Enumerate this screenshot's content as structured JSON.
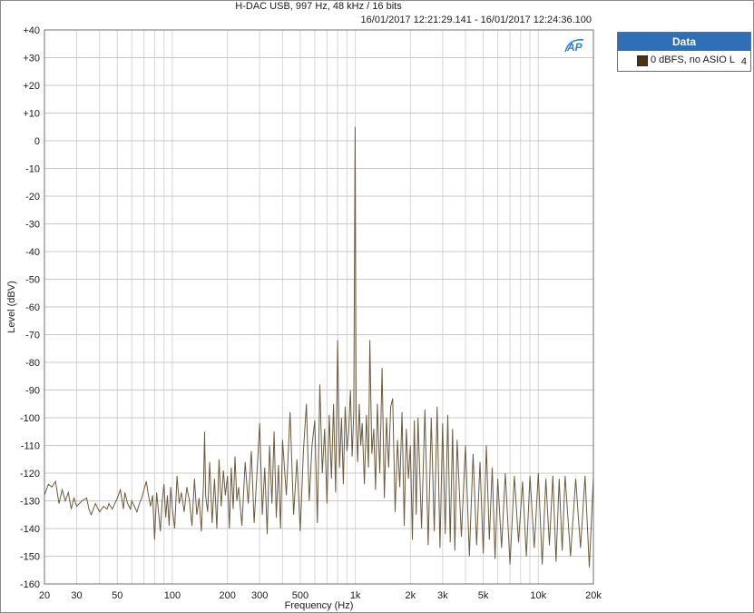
{
  "title": "H-DAC USB, 997 Hz, 48 kHz / 16 bits",
  "subtitle": "16/01/2017 12:21:29.141 - 16/01/2017 12:24:36.100",
  "legend": {
    "header": "Data",
    "entries": [
      {
        "label": "0 dBFS, no ASIO L",
        "channel": "4",
        "color": "#4a3410"
      }
    ]
  },
  "logo_text": "AP",
  "colors": {
    "trace": "#6b5a3e",
    "legend_header": "#2f6fb5",
    "grid": "#d6d6d6"
  },
  "chart_data": {
    "type": "line",
    "title": "H-DAC USB, 997 Hz, 48 kHz / 16 bits",
    "subtitle": "16/01/2017 12:21:29.141 - 16/01/2017 12:24:36.100",
    "xlabel": "Frequency (Hz)",
    "ylabel": "Level (dBV)",
    "xscale": "log",
    "xlim": [
      20,
      20000
    ],
    "ylim": [
      -160,
      40
    ],
    "x_ticks": [
      {
        "value": 20,
        "label": "20"
      },
      {
        "value": 30,
        "label": "30"
      },
      {
        "value": 50,
        "label": "50"
      },
      {
        "value": 100,
        "label": "100"
      },
      {
        "value": 200,
        "label": "200"
      },
      {
        "value": 300,
        "label": "300"
      },
      {
        "value": 500,
        "label": "500"
      },
      {
        "value": 1000,
        "label": "1k"
      },
      {
        "value": 2000,
        "label": "2k"
      },
      {
        "value": 3000,
        "label": "3k"
      },
      {
        "value": 5000,
        "label": "5k"
      },
      {
        "value": 10000,
        "label": "10k"
      },
      {
        "value": 20000,
        "label": "20k"
      }
    ],
    "y_ticks": [
      {
        "value": 40,
        "label": "+40"
      },
      {
        "value": 30,
        "label": "+30"
      },
      {
        "value": 20,
        "label": "+20"
      },
      {
        "value": 10,
        "label": "+10"
      },
      {
        "value": 0,
        "label": "0"
      },
      {
        "value": -10,
        "label": "-10"
      },
      {
        "value": -20,
        "label": "-20"
      },
      {
        "value": -30,
        "label": "-30"
      },
      {
        "value": -40,
        "label": "-40"
      },
      {
        "value": -50,
        "label": "-50"
      },
      {
        "value": -60,
        "label": "-60"
      },
      {
        "value": -70,
        "label": "-70"
      },
      {
        "value": -80,
        "label": "-80"
      },
      {
        "value": -90,
        "label": "-90"
      },
      {
        "value": -100,
        "label": "-100"
      },
      {
        "value": -110,
        "label": "-110"
      },
      {
        "value": -120,
        "label": "-120"
      },
      {
        "value": -130,
        "label": "-130"
      },
      {
        "value": -140,
        "label": "-140"
      },
      {
        "value": -150,
        "label": "-150"
      },
      {
        "value": -160,
        "label": "-160"
      }
    ],
    "grid": true,
    "legend_position": "outside-right",
    "series": [
      {
        "name": "0 dBFS, no ASIO L",
        "color": "#6b5a3e",
        "points": [
          [
            20,
            -128
          ],
          [
            21,
            -124
          ],
          [
            22,
            -125
          ],
          [
            23,
            -123
          ],
          [
            24,
            -131
          ],
          [
            25,
            -126
          ],
          [
            26,
            -130
          ],
          [
            27,
            -127
          ],
          [
            28,
            -133
          ],
          [
            29,
            -129
          ],
          [
            30,
            -132
          ],
          [
            32,
            -130
          ],
          [
            34,
            -129
          ],
          [
            35,
            -133
          ],
          [
            36,
            -135
          ],
          [
            38,
            -131
          ],
          [
            40,
            -134
          ],
          [
            42,
            -132
          ],
          [
            44,
            -133
          ],
          [
            45,
            -131
          ],
          [
            47,
            -133
          ],
          [
            50,
            -129
          ],
          [
            52,
            -126
          ],
          [
            54,
            -133
          ],
          [
            55,
            -127
          ],
          [
            57,
            -131
          ],
          [
            59,
            -133
          ],
          [
            60,
            -130
          ],
          [
            62,
            -132
          ],
          [
            64,
            -134
          ],
          [
            66,
            -131
          ],
          [
            68,
            -129
          ],
          [
            70,
            -126
          ],
          [
            72,
            -123
          ],
          [
            74,
            -128
          ],
          [
            76,
            -132
          ],
          [
            78,
            -128
          ],
          [
            80,
            -144
          ],
          [
            82,
            -127
          ],
          [
            84,
            -134
          ],
          [
            86,
            -141
          ],
          [
            88,
            -130
          ],
          [
            90,
            -124
          ],
          [
            92,
            -136
          ],
          [
            94,
            -128
          ],
          [
            96,
            -139
          ],
          [
            98,
            -125
          ],
          [
            100,
            -133
          ],
          [
            103,
            -140
          ],
          [
            106,
            -121
          ],
          [
            109,
            -131
          ],
          [
            112,
            -127
          ],
          [
            116,
            -134
          ],
          [
            120,
            -125
          ],
          [
            124,
            -130
          ],
          [
            128,
            -139
          ],
          [
            132,
            -122
          ],
          [
            136,
            -135
          ],
          [
            140,
            -129
          ],
          [
            144,
            -141
          ],
          [
            148,
            -124
          ],
          [
            150,
            -105
          ],
          [
            152,
            -128
          ],
          [
            156,
            -134
          ],
          [
            160,
            -116
          ],
          [
            165,
            -138
          ],
          [
            170,
            -122
          ],
          [
            175,
            -140
          ],
          [
            180,
            -115
          ],
          [
            185,
            -132
          ],
          [
            190,
            -119
          ],
          [
            195,
            -128
          ],
          [
            200,
            -121
          ],
          [
            205,
            -140
          ],
          [
            210,
            -118
          ],
          [
            215,
            -133
          ],
          [
            220,
            -114
          ],
          [
            225,
            -130
          ],
          [
            230,
            -125
          ],
          [
            240,
            -139
          ],
          [
            250,
            -116
          ],
          [
            260,
            -131
          ],
          [
            270,
            -112
          ],
          [
            280,
            -138
          ],
          [
            290,
            -120
          ],
          [
            300,
            -102
          ],
          [
            310,
            -135
          ],
          [
            320,
            -118
          ],
          [
            330,
            -142
          ],
          [
            340,
            -110
          ],
          [
            350,
            -131
          ],
          [
            360,
            -105
          ],
          [
            370,
            -136
          ],
          [
            380,
            -117
          ],
          [
            390,
            -140
          ],
          [
            400,
            -108
          ],
          [
            420,
            -128
          ],
          [
            440,
            -98
          ],
          [
            460,
            -135
          ],
          [
            480,
            -115
          ],
          [
            500,
            -141
          ],
          [
            520,
            -112
          ],
          [
            540,
            -95
          ],
          [
            560,
            -130
          ],
          [
            580,
            -110
          ],
          [
            600,
            -101
          ],
          [
            620,
            -138
          ],
          [
            640,
            -88
          ],
          [
            660,
            -120
          ],
          [
            680,
            -104
          ],
          [
            700,
            -131
          ],
          [
            720,
            -99
          ],
          [
            740,
            -122
          ],
          [
            760,
            -95
          ],
          [
            780,
            -127
          ],
          [
            800,
            -72
          ],
          [
            820,
            -118
          ],
          [
            840,
            -100
          ],
          [
            860,
            -124
          ],
          [
            880,
            -96
          ],
          [
            900,
            -112
          ],
          [
            920,
            -105
          ],
          [
            940,
            -90
          ],
          [
            960,
            -114
          ],
          [
            980,
            -98
          ],
          [
            997,
            5
          ],
          [
            1010,
            -100
          ],
          [
            1030,
            -116
          ],
          [
            1050,
            -95
          ],
          [
            1070,
            -110
          ],
          [
            1090,
            -102
          ],
          [
            1120,
            -124
          ],
          [
            1150,
            -99
          ],
          [
            1180,
            -118
          ],
          [
            1200,
            -72
          ],
          [
            1230,
            -113
          ],
          [
            1260,
            -104
          ],
          [
            1290,
            -126
          ],
          [
            1320,
            -95
          ],
          [
            1360,
            -120
          ],
          [
            1400,
            -82
          ],
          [
            1440,
            -129
          ],
          [
            1480,
            -100
          ],
          [
            1520,
            -118
          ],
          [
            1560,
            -96
          ],
          [
            1600,
            -93
          ],
          [
            1650,
            -134
          ],
          [
            1700,
            -108
          ],
          [
            1750,
            -125
          ],
          [
            1800,
            -98
          ],
          [
            1850,
            -139
          ],
          [
            1900,
            -104
          ],
          [
            1950,
            -122
          ],
          [
            2000,
            -110
          ],
          [
            2050,
            -144
          ],
          [
            2100,
            -101
          ],
          [
            2150,
            -135
          ],
          [
            2200,
            -100
          ],
          [
            2300,
            -140
          ],
          [
            2400,
            -97
          ],
          [
            2500,
            -146
          ],
          [
            2600,
            -100
          ],
          [
            2700,
            -141
          ],
          [
            2800,
            -96
          ],
          [
            2900,
            -147
          ],
          [
            3000,
            -102
          ],
          [
            3100,
            -142
          ],
          [
            3200,
            -99
          ],
          [
            3300,
            -145
          ],
          [
            3400,
            -104
          ],
          [
            3500,
            -148
          ],
          [
            3600,
            -108
          ],
          [
            3800,
            -143
          ],
          [
            4000,
            -110
          ],
          [
            4200,
            -150
          ],
          [
            4400,
            -113
          ],
          [
            4600,
            -146
          ],
          [
            4800,
            -116
          ],
          [
            5000,
            -149
          ],
          [
            5200,
            -110
          ],
          [
            5400,
            -144
          ],
          [
            5600,
            -118
          ],
          [
            5800,
            -151
          ],
          [
            6000,
            -122
          ],
          [
            6300,
            -147
          ],
          [
            6600,
            -120
          ],
          [
            7000,
            -153
          ],
          [
            7400,
            -121
          ],
          [
            7800,
            -145
          ],
          [
            8200,
            -123
          ],
          [
            8600,
            -150
          ],
          [
            9000,
            -121
          ],
          [
            9500,
            -147
          ],
          [
            10000,
            -120
          ],
          [
            10500,
            -153
          ],
          [
            11000,
            -122
          ],
          [
            11500,
            -146
          ],
          [
            12000,
            -121
          ],
          [
            12500,
            -152
          ],
          [
            13000,
            -122
          ],
          [
            13500,
            -148
          ],
          [
            14000,
            -121
          ],
          [
            15000,
            -150
          ],
          [
            16000,
            -122
          ],
          [
            17000,
            -147
          ],
          [
            18000,
            -121
          ],
          [
            19000,
            -154
          ],
          [
            20000,
            -121
          ]
        ]
      }
    ]
  }
}
